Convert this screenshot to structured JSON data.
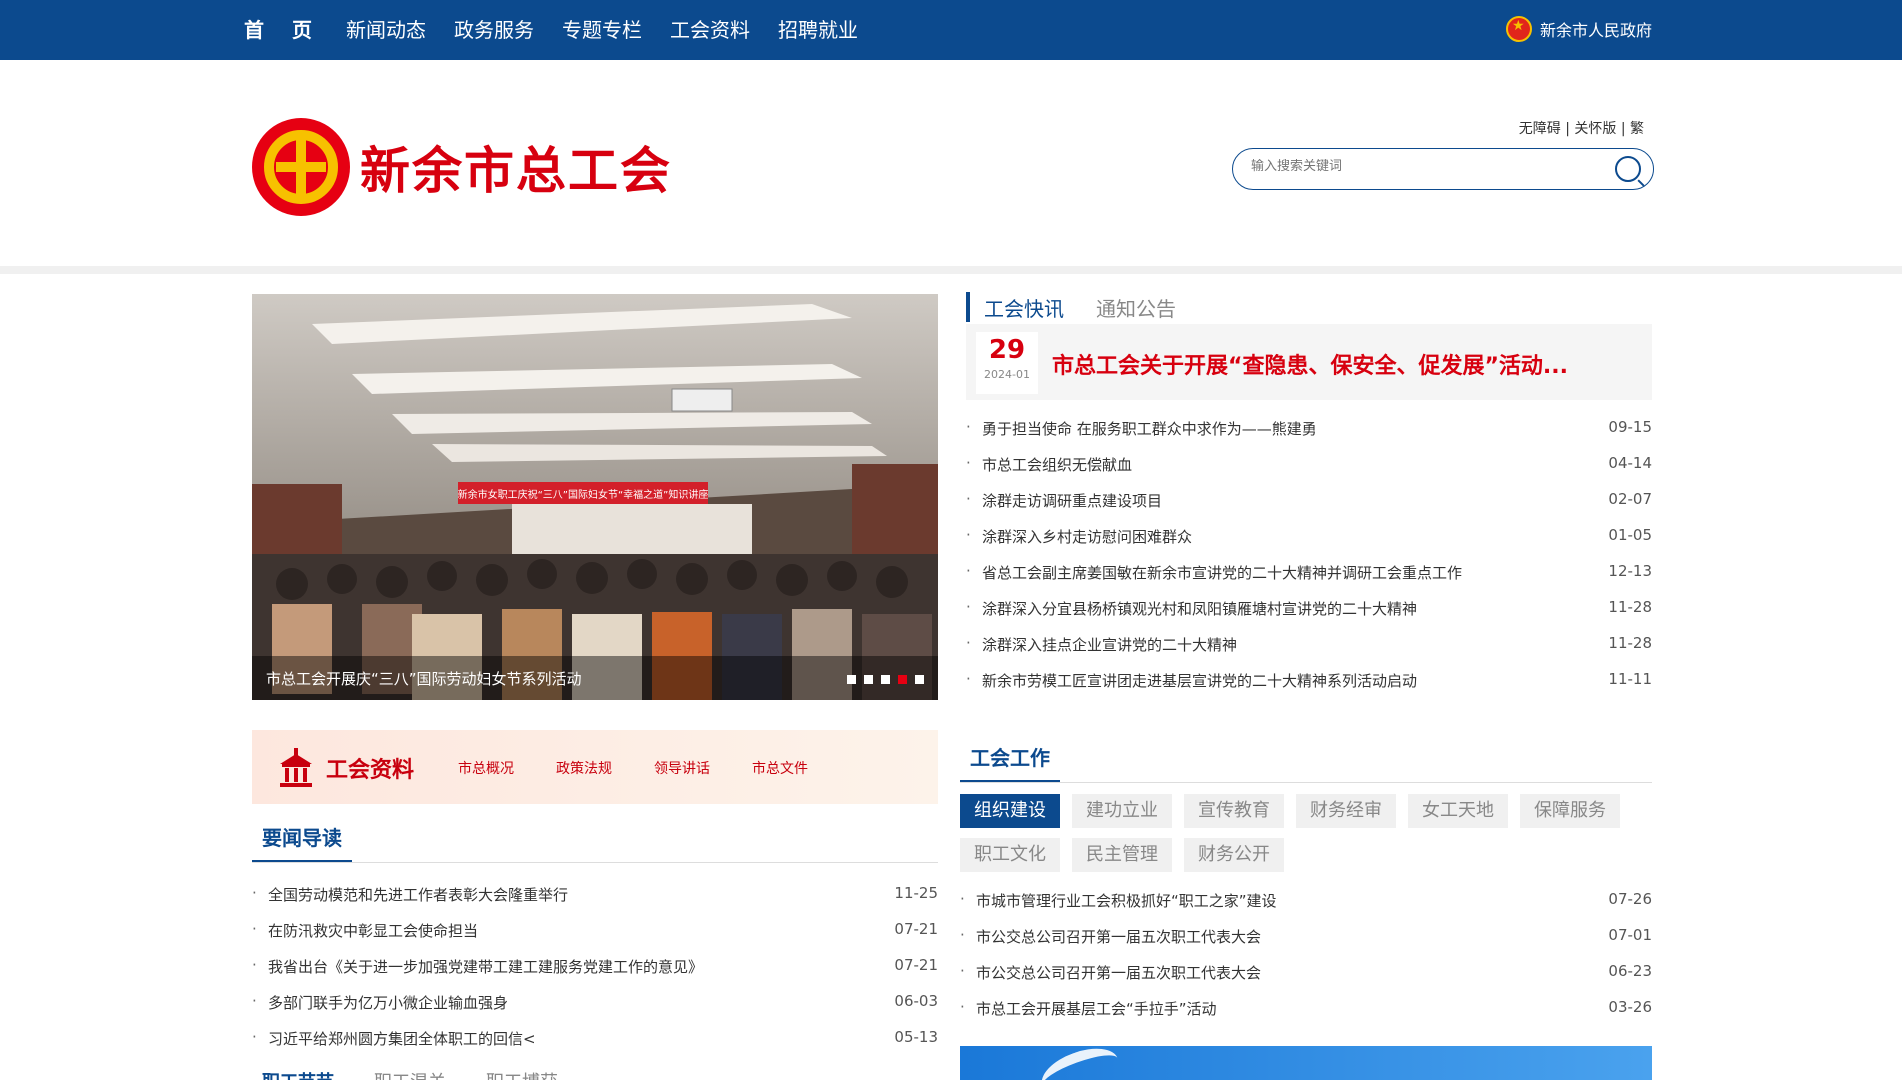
{
  "nav": {
    "items": [
      "首页",
      "新闻动态",
      "政务服务",
      "专题专栏",
      "工会资料",
      "招聘就业"
    ],
    "gov_link": "新余市人民政府"
  },
  "header": {
    "logo_text": "新余市总工会",
    "access_links": "无障碍 | 关怀版 | 繁",
    "search_placeholder": "输入搜索关键词"
  },
  "slider": {
    "caption": "市总工会开展庆“三八”国际劳动妇女节系列活动",
    "banner_text": "新余市女职工庆祝“三八”国际妇女节“幸福之道”知识讲座",
    "dots": 5,
    "active_dot": 4
  },
  "news": {
    "tabs": [
      "工会快讯",
      "通知公告"
    ],
    "headline": {
      "day": "29",
      "ym": "2024-01",
      "title": "市总工会关于开展“查隐患、保安全、促发展”活动..."
    },
    "items": [
      {
        "title": "勇于担当使命 在服务职工群众中求作为——熊建勇",
        "date": "09-15"
      },
      {
        "title": "市总工会组织无偿献血",
        "date": "04-14"
      },
      {
        "title": "涂群走访调研重点建设项目",
        "date": "02-07"
      },
      {
        "title": "涂群深入乡村走访慰问困难群众",
        "date": "01-05"
      },
      {
        "title": "省总工会副主席姜国敏在新余市宣讲党的二十大精神并调研工会重点工作",
        "date": "12-13"
      },
      {
        "title": "涂群深入分宜县杨桥镇观光村和凤阳镇雁塘村宣讲党的二十大精神",
        "date": "11-28"
      },
      {
        "title": "涂群深入挂点企业宣讲党的二十大精神",
        "date": "11-28"
      },
      {
        "title": "新余市劳模工匠宣讲团走进基层宣讲党的二十大精神系列活动启动",
        "date": "11-11"
      }
    ]
  },
  "resources": {
    "title": "工会资料",
    "links": [
      "市总概况",
      "政策法规",
      "领导讲话",
      "市总文件"
    ]
  },
  "important": {
    "title": "要闻导读",
    "items": [
      {
        "title": "全国劳动模范和先进工作者表彰大会隆重举行",
        "date": "11-25"
      },
      {
        "title": "在防汛救灾中彰显工会使命担当",
        "date": "07-21"
      },
      {
        "title": "我省出台《关于进一步加强党建带工建工建服务党建工作的意见》",
        "date": "07-21"
      },
      {
        "title": "多部门联手为亿万小微企业输血强身",
        "date": "06-03"
      },
      {
        "title": "习近平给郑州圆方集团全体职工的回信<",
        "date": "05-13"
      }
    ]
  },
  "work": {
    "title": "工会工作",
    "tags": [
      "组织建设",
      "建功立业",
      "宣传教育",
      "财务经审",
      "女工天地",
      "保障服务",
      "职工文化",
      "民主管理",
      "财务公开"
    ],
    "items": [
      {
        "title": "市城市管理行业工会积极抓好“职工之家”建设",
        "date": "07-26"
      },
      {
        "title": "市公交总公司召开第一届五次职工代表大会",
        "date": "07-01"
      },
      {
        "title": "市公交总公司召开第一届五次职工代表大会",
        "date": "06-23"
      },
      {
        "title": "市总工会开展基层工会“手拉手”活动",
        "date": "03-26"
      }
    ]
  },
  "bottom_tabs": [
    "职工节节",
    "职工混关",
    "职工博获"
  ],
  "colors": {
    "primary": "#0c4a8e",
    "accent_red": "#d7000f",
    "gold": "#f7c100"
  }
}
